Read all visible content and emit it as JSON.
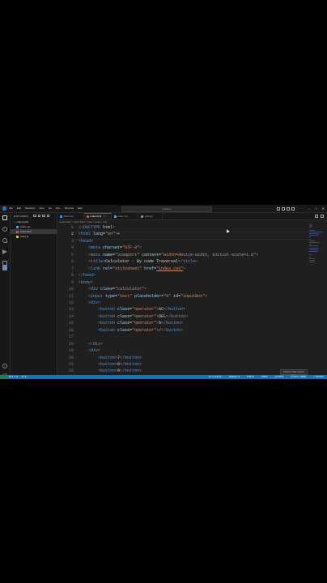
{
  "titlebar": {
    "menu": [
      "File",
      "Edit",
      "Selection",
      "View",
      "Go",
      "Run",
      "Terminal",
      "Help"
    ],
    "search_placeholder": "cwdemo"
  },
  "sidebar": {
    "title": "EXPLORER",
    "folder": "codemodel",
    "files": [
      {
        "name": "index.css",
        "color": "#42a5f5"
      },
      {
        "name": "index.html",
        "color": "#e44d26",
        "selected": true
      },
      {
        "name": "index.js",
        "color": "#cbcb41"
      }
    ]
  },
  "tabs": [
    {
      "label": "Welcome",
      "color": "#3794ff",
      "active": false
    },
    {
      "label": "index.html",
      "color": "#e44d26",
      "active": true
    },
    {
      "label": "index.css",
      "color": "#42a5f5",
      "active": false
    },
    {
      "label": "settings",
      "color": "#888888",
      "active": false
    }
  ],
  "breadcrumb": "codemodel > index.html > html > head > link",
  "editor": {
    "line_numbers": [
      "1",
      "2",
      "3",
      "4",
      "5",
      "6",
      "7",
      "8",
      "9",
      "10",
      "11",
      "12",
      "13",
      "14",
      "15",
      "16",
      "17",
      "18",
      "19",
      "20",
      "21",
      "22"
    ],
    "current_line": "2",
    "lines": [
      [
        {
          "t": "<!",
          "c": "t-brk"
        },
        {
          "t": "DOCTYPE",
          "c": "t-tag"
        },
        {
          "t": " html",
          "c": "t-attr"
        },
        {
          "t": ">",
          "c": "t-brk"
        }
      ],
      [
        {
          "t": "<",
          "c": "t-brk"
        },
        {
          "t": "html",
          "c": "t-tag"
        },
        {
          "t": " lang",
          "c": "t-attr"
        },
        {
          "t": "=",
          "c": "t-txt"
        },
        {
          "t": "\"en\"",
          "c": "t-str"
        },
        {
          "t": ">",
          "c": "t-brk"
        },
        {
          "t": "+",
          "c": "t-txt"
        }
      ],
      [
        {
          "t": "<",
          "c": "t-brk"
        },
        {
          "t": "head",
          "c": "t-tag"
        },
        {
          "t": ">",
          "c": "t-brk"
        }
      ],
      [
        {
          "t": "    <",
          "c": "t-brk"
        },
        {
          "t": "meta",
          "c": "t-tag"
        },
        {
          "t": " charset",
          "c": "t-attr"
        },
        {
          "t": "=",
          "c": "t-txt"
        },
        {
          "t": "\"UTF-8\"",
          "c": "t-str"
        },
        {
          "t": ">",
          "c": "t-brk"
        }
      ],
      [
        {
          "t": "    <",
          "c": "t-brk"
        },
        {
          "t": "meta",
          "c": "t-tag"
        },
        {
          "t": " name",
          "c": "t-attr"
        },
        {
          "t": "=",
          "c": "t-txt"
        },
        {
          "t": "\"viewport\"",
          "c": "t-str"
        },
        {
          "t": " content",
          "c": "t-attr"
        },
        {
          "t": "=",
          "c": "t-txt"
        },
        {
          "t": "\"width=device-width, initial-scale=1.0\"",
          "c": "t-str"
        },
        {
          "t": ">",
          "c": "t-brk"
        }
      ],
      [
        {
          "t": "    <",
          "c": "t-brk"
        },
        {
          "t": "title",
          "c": "t-tag"
        },
        {
          "t": ">",
          "c": "t-brk"
        },
        {
          "t": "Calculator - By code Traversal",
          "c": "t-txt"
        },
        {
          "t": "</",
          "c": "t-brk"
        },
        {
          "t": "title",
          "c": "t-tag"
        },
        {
          "t": ">",
          "c": "t-brk"
        }
      ],
      [
        {
          "t": "    <",
          "c": "t-brk"
        },
        {
          "t": "link",
          "c": "t-tag"
        },
        {
          "t": " rel",
          "c": "t-attr"
        },
        {
          "t": "=",
          "c": "t-txt"
        },
        {
          "t": "\"stylesheet\"",
          "c": "t-str"
        },
        {
          "t": " href",
          "c": "t-attr"
        },
        {
          "t": "=",
          "c": "t-txt"
        },
        {
          "t": "\"index.css\"",
          "c": "t-str t-link"
        },
        {
          "t": ">",
          "c": "t-brk"
        }
      ],
      [
        {
          "t": "</",
          "c": "t-brk"
        },
        {
          "t": "head",
          "c": "t-tag"
        },
        {
          "t": ">",
          "c": "t-brk"
        }
      ],
      [
        {
          "t": "<",
          "c": "t-brk"
        },
        {
          "t": "body",
          "c": "t-tag"
        },
        {
          "t": ">",
          "c": "t-brk"
        }
      ],
      [
        {
          "t": "    <",
          "c": "t-brk"
        },
        {
          "t": "div",
          "c": "t-tag"
        },
        {
          "t": " class",
          "c": "t-attr"
        },
        {
          "t": "=",
          "c": "t-txt"
        },
        {
          "t": "\"calculator\"",
          "c": "t-str"
        },
        {
          "t": ">",
          "c": "t-brk"
        }
      ],
      [
        {
          "t": "    <",
          "c": "t-brk"
        },
        {
          "t": "input",
          "c": "t-tag"
        },
        {
          "t": " type",
          "c": "t-attr"
        },
        {
          "t": "=",
          "c": "t-txt"
        },
        {
          "t": "\"text\"",
          "c": "t-str"
        },
        {
          "t": " placeholder",
          "c": "t-attr"
        },
        {
          "t": "=",
          "c": "t-txt"
        },
        {
          "t": "\"0\"",
          "c": "t-str"
        },
        {
          "t": " id",
          "c": "t-attr"
        },
        {
          "t": "=",
          "c": "t-txt"
        },
        {
          "t": "\"inputBox\"",
          "c": "t-str"
        },
        {
          "t": ">",
          "c": "t-brk"
        }
      ],
      [
        {
          "t": "    <",
          "c": "t-brk"
        },
        {
          "t": "div",
          "c": "t-tag"
        },
        {
          "t": ">",
          "c": "t-brk"
        }
      ],
      [
        {
          "t": "        <",
          "c": "t-brk"
        },
        {
          "t": "button",
          "c": "t-tag"
        },
        {
          "t": " class",
          "c": "t-attr"
        },
        {
          "t": "=",
          "c": "t-txt"
        },
        {
          "t": "\"operator\"",
          "c": "t-str"
        },
        {
          "t": ">",
          "c": "t-brk"
        },
        {
          "t": "AC",
          "c": "t-txt"
        },
        {
          "t": "</",
          "c": "t-brk"
        },
        {
          "t": "button",
          "c": "t-tag"
        },
        {
          "t": ">",
          "c": "t-brk"
        }
      ],
      [
        {
          "t": "        <",
          "c": "t-brk"
        },
        {
          "t": "button",
          "c": "t-tag"
        },
        {
          "t": " class",
          "c": "t-attr"
        },
        {
          "t": "=",
          "c": "t-txt"
        },
        {
          "t": "\"operator\"",
          "c": "t-str"
        },
        {
          "t": ">",
          "c": "t-brk"
        },
        {
          "t": "DEL",
          "c": "t-txt"
        },
        {
          "t": "</",
          "c": "t-brk"
        },
        {
          "t": "button",
          "c": "t-tag"
        },
        {
          "t": ">",
          "c": "t-brk"
        }
      ],
      [
        {
          "t": "        <",
          "c": "t-brk"
        },
        {
          "t": "button",
          "c": "t-tag"
        },
        {
          "t": " class",
          "c": "t-attr"
        },
        {
          "t": "=",
          "c": "t-txt"
        },
        {
          "t": "\"operator\"",
          "c": "t-str"
        },
        {
          "t": ">",
          "c": "t-brk"
        },
        {
          "t": "%",
          "c": "t-txt"
        },
        {
          "t": "</",
          "c": "t-brk"
        },
        {
          "t": "button",
          "c": "t-tag"
        },
        {
          "t": ">",
          "c": "t-brk"
        }
      ],
      [
        {
          "t": "        <",
          "c": "t-brk"
        },
        {
          "t": "button",
          "c": "t-tag"
        },
        {
          "t": " class",
          "c": "t-attr"
        },
        {
          "t": "=",
          "c": "t-txt"
        },
        {
          "t": "\"operator\"",
          "c": "t-str"
        },
        {
          "t": ">",
          "c": "t-brk"
        },
        {
          "t": "/",
          "c": "t-txt"
        },
        {
          "t": "</",
          "c": "t-brk"
        },
        {
          "t": "button",
          "c": "t-tag"
        },
        {
          "t": ">",
          "c": "t-brk"
        }
      ],
      [],
      [
        {
          "t": "    </",
          "c": "t-brk"
        },
        {
          "t": "div",
          "c": "t-tag"
        },
        {
          "t": ">",
          "c": "t-brk"
        }
      ],
      [
        {
          "t": "    <",
          "c": "t-brk"
        },
        {
          "t": "div",
          "c": "t-tag"
        },
        {
          "t": ">",
          "c": "t-brk"
        }
      ],
      [
        {
          "t": "        <",
          "c": "t-brk"
        },
        {
          "t": "button",
          "c": "t-tag"
        },
        {
          "t": ">",
          "c": "t-brk"
        },
        {
          "t": "7",
          "c": "t-txt"
        },
        {
          "t": "</",
          "c": "t-brk"
        },
        {
          "t": "button",
          "c": "t-tag"
        },
        {
          "t": ">",
          "c": "t-brk"
        }
      ],
      [
        {
          "t": "        <",
          "c": "t-brk"
        },
        {
          "t": "button",
          "c": "t-tag"
        },
        {
          "t": ">",
          "c": "t-brk"
        },
        {
          "t": "8",
          "c": "t-txt"
        },
        {
          "t": "</",
          "c": "t-brk"
        },
        {
          "t": "button",
          "c": "t-tag"
        },
        {
          "t": ">",
          "c": "t-brk"
        }
      ],
      [
        {
          "t": "        <",
          "c": "t-brk"
        },
        {
          "t": "button",
          "c": "t-tag"
        },
        {
          "t": ">",
          "c": "t-brk"
        },
        {
          "t": "9",
          "c": "t-txt"
        },
        {
          "t": "</",
          "c": "t-brk"
        },
        {
          "t": "button",
          "c": "t-tag"
        },
        {
          "t": ">",
          "c": "t-brk"
        }
      ]
    ]
  },
  "tooltip": "Click to view server",
  "statusbar": {
    "left": [
      "⊗ 0 ⚠ 0",
      "⚡ 0"
    ],
    "right": [
      "Ln 2, Col 11",
      "Spaces: 4",
      "UTF-8",
      "CRLF",
      "{} HTML",
      "⦿ Port : 5500",
      "✓ Prettier"
    ]
  },
  "colors": {
    "accent": "#007acc",
    "editor_bg": "#1f1f1f",
    "tag": "#569cd6",
    "attr": "#9cdcfe",
    "string": "#ce9178"
  }
}
